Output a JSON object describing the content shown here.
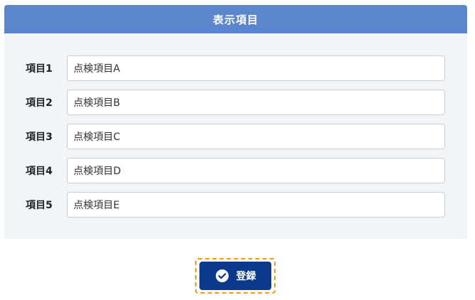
{
  "panel": {
    "title": "表示項目",
    "header_color": "#5b86cb",
    "items": [
      {
        "label": "項目1",
        "value": "点検項目A"
      },
      {
        "label": "項目2",
        "value": "点検項目B"
      },
      {
        "label": "項目3",
        "value": "点検項目C"
      },
      {
        "label": "項目4",
        "value": "点検項目D"
      },
      {
        "label": "項目5",
        "value": "点検項目E"
      }
    ]
  },
  "actions": {
    "register_label": "登録",
    "register_icon": "check-circle-icon",
    "button_color": "#0b3a8c",
    "focus_outline_color": "#f29a1f"
  }
}
